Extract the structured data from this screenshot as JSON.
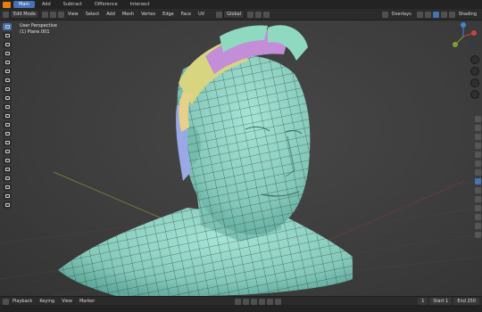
{
  "topbar": {
    "tabs": [
      {
        "label": "Main",
        "active": true
      },
      {
        "label": "Add",
        "active": false
      },
      {
        "label": "Subtract",
        "active": false
      },
      {
        "label": "Difference",
        "active": false
      },
      {
        "label": "Intersect",
        "active": false
      }
    ],
    "right_icons": [
      "overlays-icon",
      "shading-solid-icon",
      "shading-material-icon",
      "shading-rendered-icon",
      "shading-wire-icon"
    ],
    "overlays_label": "Overlays",
    "shading_label": "Shading"
  },
  "header": {
    "mode": "Edit Mode",
    "menus": [
      "View",
      "Select",
      "Add",
      "Mesh",
      "Vertex",
      "Edge",
      "Face",
      "UV"
    ],
    "transform": "Global"
  },
  "viewport": {
    "perspective": "User Perspective",
    "object": "(1) Plane.001"
  },
  "timeline": {
    "menus": [
      "Playback",
      "Keying",
      "View",
      "Marker"
    ],
    "current_frame": "1",
    "start_label": "Start 1",
    "end_label": "End 250"
  },
  "colors": {
    "mesh": "#8fd3c4",
    "mesh_shadow": "#5ea79a",
    "wire": "#1a2a26",
    "hair": [
      "#c38dd8",
      "#8fd9c1",
      "#e7d08a",
      "#9aa8e6",
      "#d7d57f"
    ],
    "accent": "#4772b3"
  }
}
